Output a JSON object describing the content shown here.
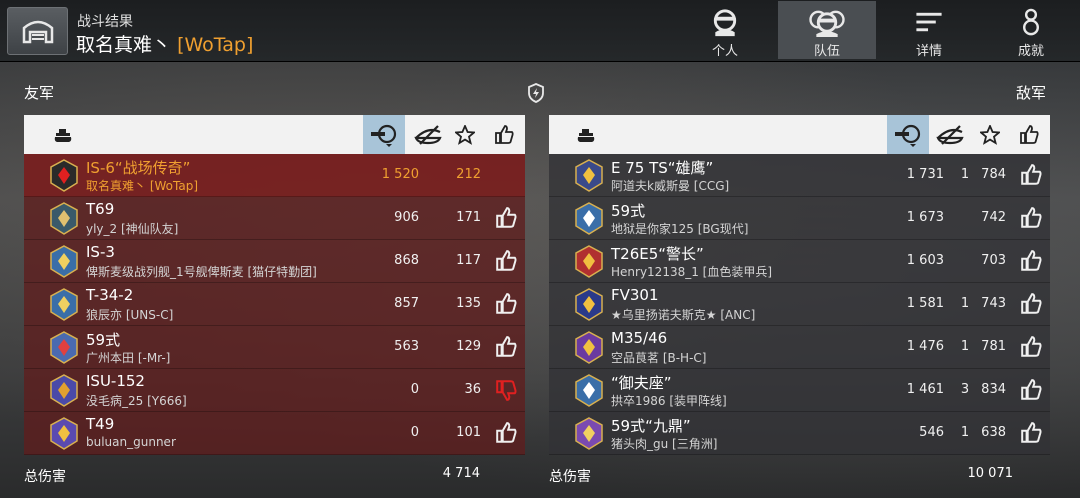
{
  "header": {
    "subtitle": "战斗结果",
    "player_name": "取名真难丶",
    "player_clan": "[WoTap]",
    "tabs": [
      {
        "label": "个人",
        "icon": "personal-icon"
      },
      {
        "label": "队伍",
        "icon": "team-icon"
      },
      {
        "label": "详情",
        "icon": "details-icon"
      },
      {
        "label": "成就",
        "icon": "medal-icon"
      }
    ],
    "active_tab": "队伍"
  },
  "ally": {
    "label": "友军",
    "total_label": "总伤害",
    "total_damage": "4 714",
    "rows": [
      {
        "tank": "IS-6“战场传奇”",
        "player": "取名真难丶 [WoTap]",
        "damage": "1 520",
        "kills": "",
        "score": "212",
        "me": true,
        "badge_color": "#2a2a2a",
        "accent": "#e02020",
        "thumb": "none"
      },
      {
        "tank": "T69",
        "player": "yly_2 [神仙队友]",
        "damage": "906",
        "kills": "",
        "score": "171",
        "me": false,
        "badge_color": "#3a5a6a",
        "accent": "#e0c070",
        "thumb": "up"
      },
      {
        "tank": "IS-3",
        "player": "俾斯麦级战列舰_1号舰俾斯麦 [猫仔特勤团]",
        "damage": "868",
        "kills": "",
        "score": "117",
        "me": false,
        "badge_color": "#3a6ea8",
        "accent": "#f0d060",
        "thumb": "up"
      },
      {
        "tank": "T-34-2",
        "player": "狼辰亦 [UNS-C]",
        "damage": "857",
        "kills": "",
        "score": "135",
        "me": false,
        "badge_color": "#3a6ea8",
        "accent": "#f0d060",
        "thumb": "up"
      },
      {
        "tank": "59式",
        "player": "广州本田 [-Mr-]",
        "damage": "563",
        "kills": "",
        "score": "129",
        "me": false,
        "badge_color": "#4a6ab0",
        "accent": "#e04040",
        "thumb": "up"
      },
      {
        "tank": "ISU-152",
        "player": "没毛病_25 [Y666]",
        "damage": "0",
        "kills": "",
        "score": "36",
        "me": false,
        "badge_color": "#4a4aa8",
        "accent": "#e0a030",
        "thumb": "down"
      },
      {
        "tank": "T49",
        "player": "buluan_gunner",
        "damage": "0",
        "kills": "",
        "score": "101",
        "me": false,
        "badge_color": "#5a4ab0",
        "accent": "#f0c040",
        "thumb": "up"
      }
    ]
  },
  "enemy": {
    "label": "敌军",
    "total_label": "总伤害",
    "total_damage": "10 071",
    "rows": [
      {
        "tank": "E 75 TS“雄鹰”",
        "player": "阿道夫k威斯曼 [CCG]",
        "damage": "1 731",
        "kills": "1",
        "score": "784",
        "badge_color": "#3a4a8a",
        "accent": "#f0c040",
        "thumb": "up"
      },
      {
        "tank": "59式",
        "player": "地狱是你家125 [BG现代]",
        "damage": "1 673",
        "kills": "",
        "score": "742",
        "badge_color": "#3a6ea8",
        "accent": "#ffffff",
        "thumb": "up"
      },
      {
        "tank": "T26E5“警长”",
        "player": "Henry12138_1 [血色装甲兵]",
        "damage": "1 603",
        "kills": "",
        "score": "703",
        "badge_color": "#b03030",
        "accent": "#f0c040",
        "thumb": "up"
      },
      {
        "tank": "FV301",
        "player": "★乌里扬诺夫斯克★ [ANC]",
        "damage": "1 581",
        "kills": "1",
        "score": "743",
        "badge_color": "#2a3a8a",
        "accent": "#f0c040",
        "thumb": "up"
      },
      {
        "tank": "M35/46",
        "player": "空品茛茗 [B-H-C]",
        "damage": "1 476",
        "kills": "1",
        "score": "781",
        "badge_color": "#6a3aa0",
        "accent": "#f0c040",
        "thumb": "up"
      },
      {
        "tank": "“御夫座”",
        "player": "拱卒1986 [装甲阵线]",
        "damage": "1 461",
        "kills": "3",
        "score": "834",
        "badge_color": "#3a6ea8",
        "accent": "#ffffff",
        "thumb": "up"
      },
      {
        "tank": "59式“九鼎”",
        "player": "猪头肉_gu [三角洲]",
        "damage": "546",
        "kills": "1",
        "score": "638",
        "badge_color": "#7a4ab0",
        "accent": "#f0d060",
        "thumb": "up"
      }
    ]
  }
}
